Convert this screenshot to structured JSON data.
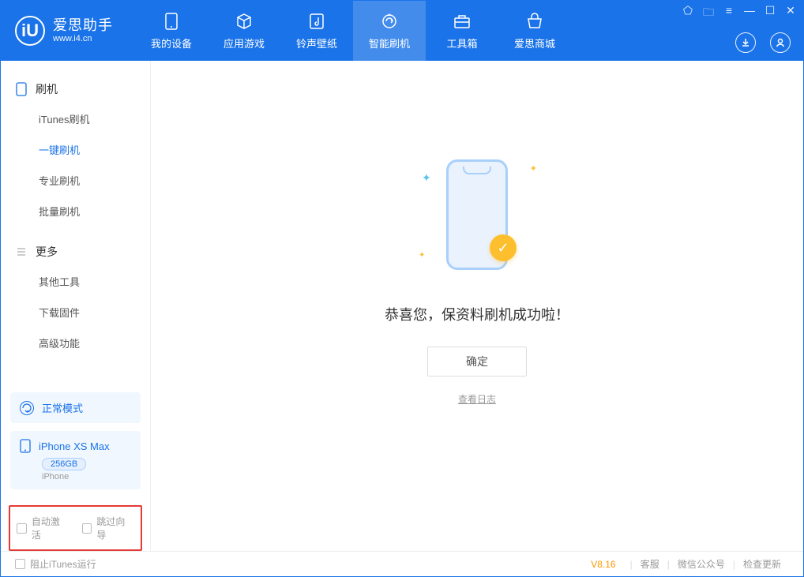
{
  "app": {
    "name_cn": "爱思助手",
    "url": "www.i4.cn",
    "logo_letter": "iU"
  },
  "nav": {
    "items": [
      {
        "label": "我的设备",
        "icon": "device-icon"
      },
      {
        "label": "应用游戏",
        "icon": "cube-icon"
      },
      {
        "label": "铃声壁纸",
        "icon": "music-icon"
      },
      {
        "label": "智能刷机",
        "icon": "refresh-icon",
        "active": true
      },
      {
        "label": "工具箱",
        "icon": "toolbox-icon"
      },
      {
        "label": "爱思商城",
        "icon": "shop-icon"
      }
    ]
  },
  "sidebar": {
    "group1": {
      "title": "刷机",
      "items": [
        "iTunes刷机",
        "一键刷机",
        "专业刷机",
        "批量刷机"
      ],
      "active_index": 1
    },
    "group2": {
      "title": "更多",
      "items": [
        "其他工具",
        "下载固件",
        "高级功能"
      ]
    },
    "mode_card": "正常模式",
    "device": {
      "name": "iPhone XS Max",
      "capacity": "256GB",
      "type": "iPhone"
    },
    "checkbox1": "自动激活",
    "checkbox2": "跳过向导"
  },
  "main": {
    "success_text": "恭喜您，保资料刷机成功啦！",
    "ok_button": "确定",
    "log_link": "查看日志"
  },
  "footer": {
    "block_itunes": "阻止iTunes运行",
    "version": "V8.16",
    "links": [
      "客服",
      "微信公众号",
      "检查更新"
    ]
  }
}
